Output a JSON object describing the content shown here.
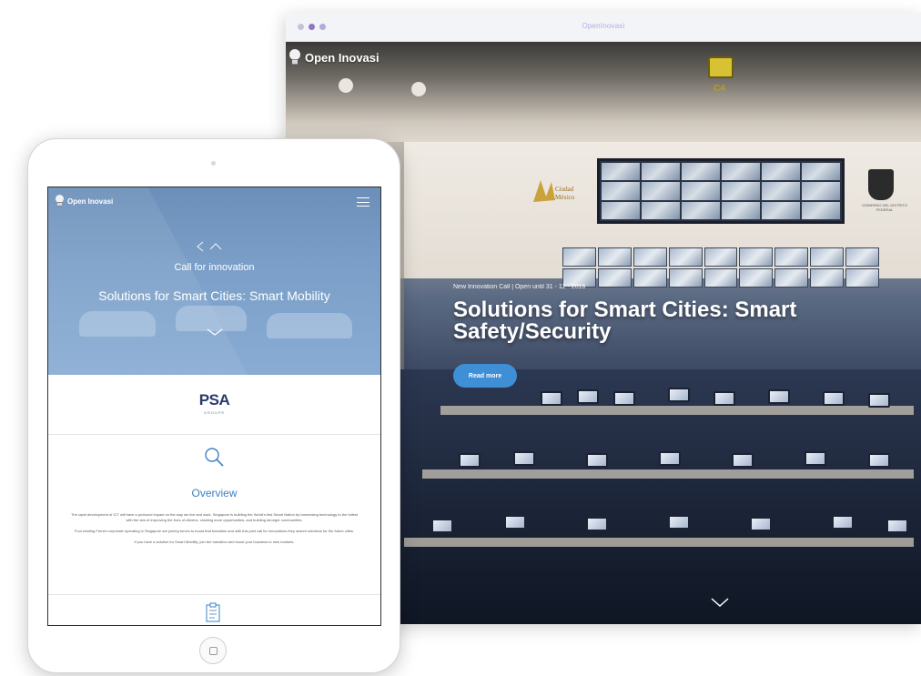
{
  "browser": {
    "title": "OpenInovasi"
  },
  "desktop_site": {
    "logo_text": "Open Inovasi",
    "sign_label": "C4",
    "emblem_text": "Ciudad México",
    "crest_caption": "GOBIERNO DEL DISTRITO FEDERAL",
    "meta": "New Innovation Call | Open until 31 - 12 - 2016",
    "heading": "Solutions for Smart Cities: Smart Safety/Security",
    "read_more_label": "Read more",
    "scroll_icon": "chevron-down-icon"
  },
  "tablet_site": {
    "logo_text": "Open Inovasi",
    "menu_icon": "hamburger-icon",
    "kicker": "Call for innovation",
    "heading": "Solutions for Smart Cities: Smart Mobility",
    "partner_logo": "PSA",
    "partner_logo_sub": "GROUPE",
    "overview_icon": "search-icon",
    "overview_title": "Overview",
    "overview_paragraphs": [
      "The rapid development of ICT will have a profound impact on the way we live and work. Singapore is building the World's first Smart Nation by harnessing technology to the fullest with the aim of improving the lives of citizens, creating more opportunities, and building stronger communities.",
      "Four leading French corporate operating in Singapore are joining forces to boost that transition and with this joint call for innovations they search solutions for the future cities.",
      "If you have a solution for Smart Mobility, join the transition and boost your business to new markets."
    ],
    "next_section_icon": "clipboard-icon"
  },
  "colors": {
    "accent_blue": "#3f8fd7",
    "overview_blue": "#3d80c4",
    "psa_navy": "#2a3a6a"
  }
}
